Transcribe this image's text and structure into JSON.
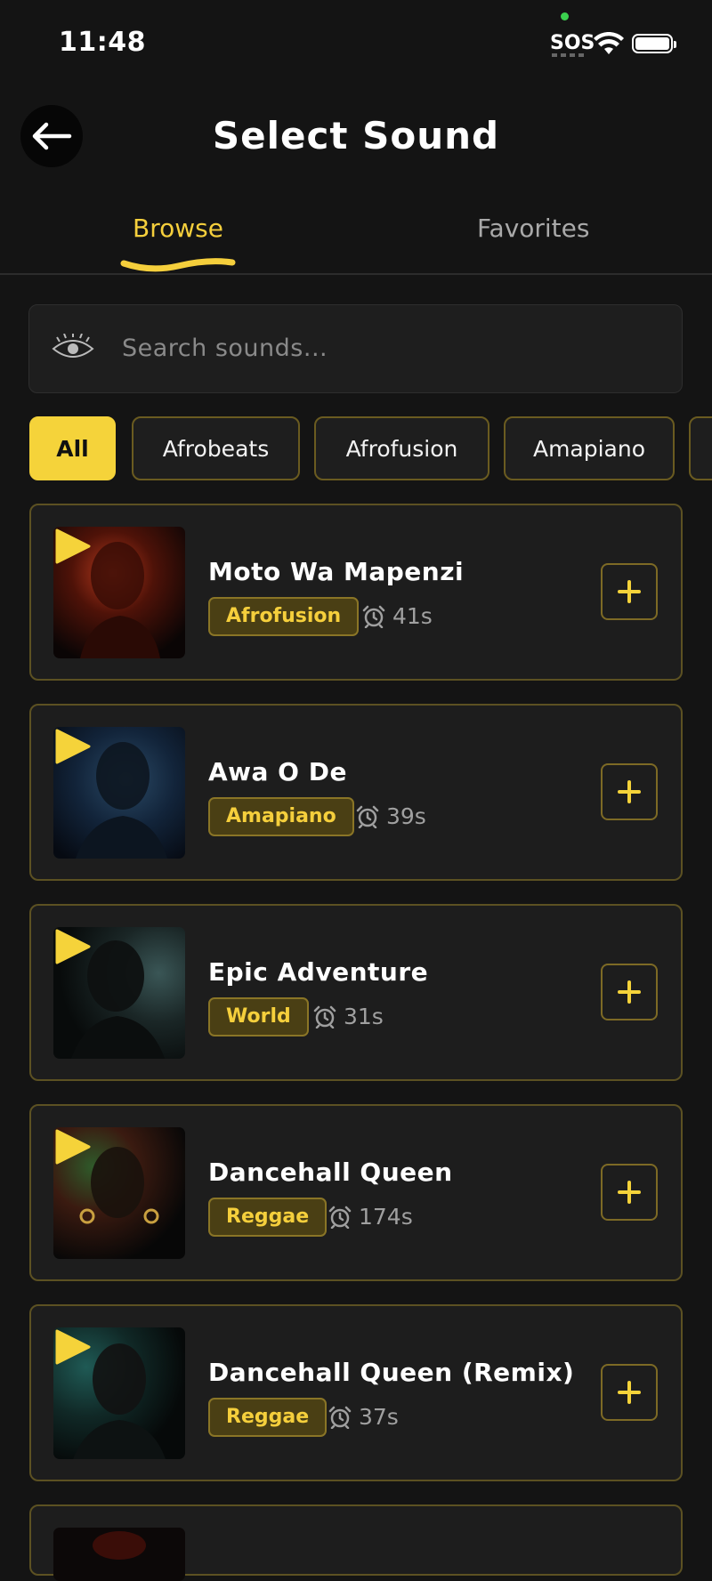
{
  "status_bar": {
    "time": "11:48",
    "carrier": "SOS"
  },
  "header": {
    "title": "Select Sound"
  },
  "tabs": [
    {
      "label": "Browse",
      "active": true
    },
    {
      "label": "Favorites",
      "active": false
    }
  ],
  "search": {
    "placeholder": "Search sounds..."
  },
  "filters": [
    "All",
    "Afrobeats",
    "Afrofusion",
    "Amapiano"
  ],
  "sounds": [
    {
      "title": "Moto Wa Mapenzi",
      "genre": "Afrofusion",
      "duration": "41s"
    },
    {
      "title": "Awa O De",
      "genre": "Amapiano",
      "duration": "39s"
    },
    {
      "title": "Epic Adventure",
      "genre": "World",
      "duration": "31s"
    },
    {
      "title": "Dancehall Queen",
      "genre": "Reggae",
      "duration": "174s"
    },
    {
      "title": "Dancehall Queen (Remix)",
      "genre": "Reggae",
      "duration": "37s"
    }
  ],
  "icons": {
    "back": "arrow-left-icon",
    "search": "eye-icon",
    "play": "play-icon",
    "duration": "alarm-clock-icon",
    "add": "plus-icon"
  },
  "colors": {
    "accent": "#f5d33a",
    "background": "#141414",
    "card": "#1d1d1d"
  }
}
